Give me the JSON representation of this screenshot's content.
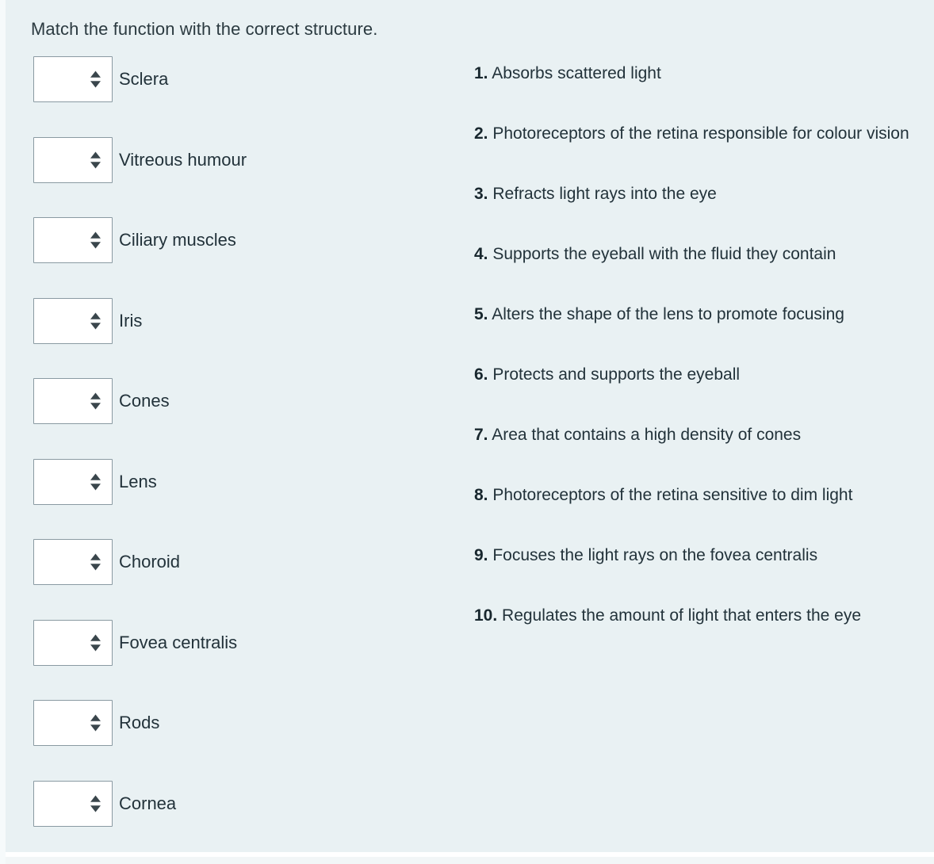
{
  "prompt": {
    "text": "Match the function with the correct structure."
  },
  "colors": {
    "page_background": "#f4f8f9",
    "panel_background": "#e9f1f3",
    "text": "#22323a",
    "select_border": "#8a9aa2",
    "select_fill": "#ffffff",
    "spinner_arrow": "#3a464c"
  },
  "structures": [
    {
      "label": "Sclera",
      "select_value": "",
      "icon": "select-spinner-icon"
    },
    {
      "label": "Vitreous humour",
      "select_value": "",
      "icon": "select-spinner-icon"
    },
    {
      "label": "Ciliary muscles",
      "select_value": "",
      "icon": "select-spinner-icon"
    },
    {
      "label": "Iris",
      "select_value": "",
      "icon": "select-spinner-icon"
    },
    {
      "label": "Cones",
      "select_value": "",
      "icon": "select-spinner-icon"
    },
    {
      "label": "Lens",
      "select_value": "",
      "icon": "select-spinner-icon"
    },
    {
      "label": "Choroid",
      "select_value": "",
      "icon": "select-spinner-icon"
    },
    {
      "label": "Fovea centralis",
      "select_value": "",
      "icon": "select-spinner-icon"
    },
    {
      "label": "Rods",
      "select_value": "",
      "icon": "select-spinner-icon"
    },
    {
      "label": "Cornea",
      "select_value": "",
      "icon": "select-spinner-icon"
    }
  ],
  "functions": [
    {
      "number": "1.",
      "text": " Absorbs scattered light"
    },
    {
      "number": "2.",
      "text": " Photoreceptors of the retina responsible for colour vision"
    },
    {
      "number": "3.",
      "text": " Refracts light rays into the eye"
    },
    {
      "number": "4.",
      "text": " Supports the eyeball with the fluid they contain"
    },
    {
      "number": "5.",
      "text": " Alters the shape of the lens to promote focusing"
    },
    {
      "number": "6.",
      "text": " Protects and supports the eyeball"
    },
    {
      "number": "7.",
      "text": " Area that contains a high density of cones"
    },
    {
      "number": "8.",
      "text": " Photoreceptors of the retina sensitive to dim light"
    },
    {
      "number": "9.",
      "text": " Focuses the light rays on the fovea centralis"
    },
    {
      "number": "10.",
      "text": " Regulates the amount of light that enters the eye"
    }
  ]
}
